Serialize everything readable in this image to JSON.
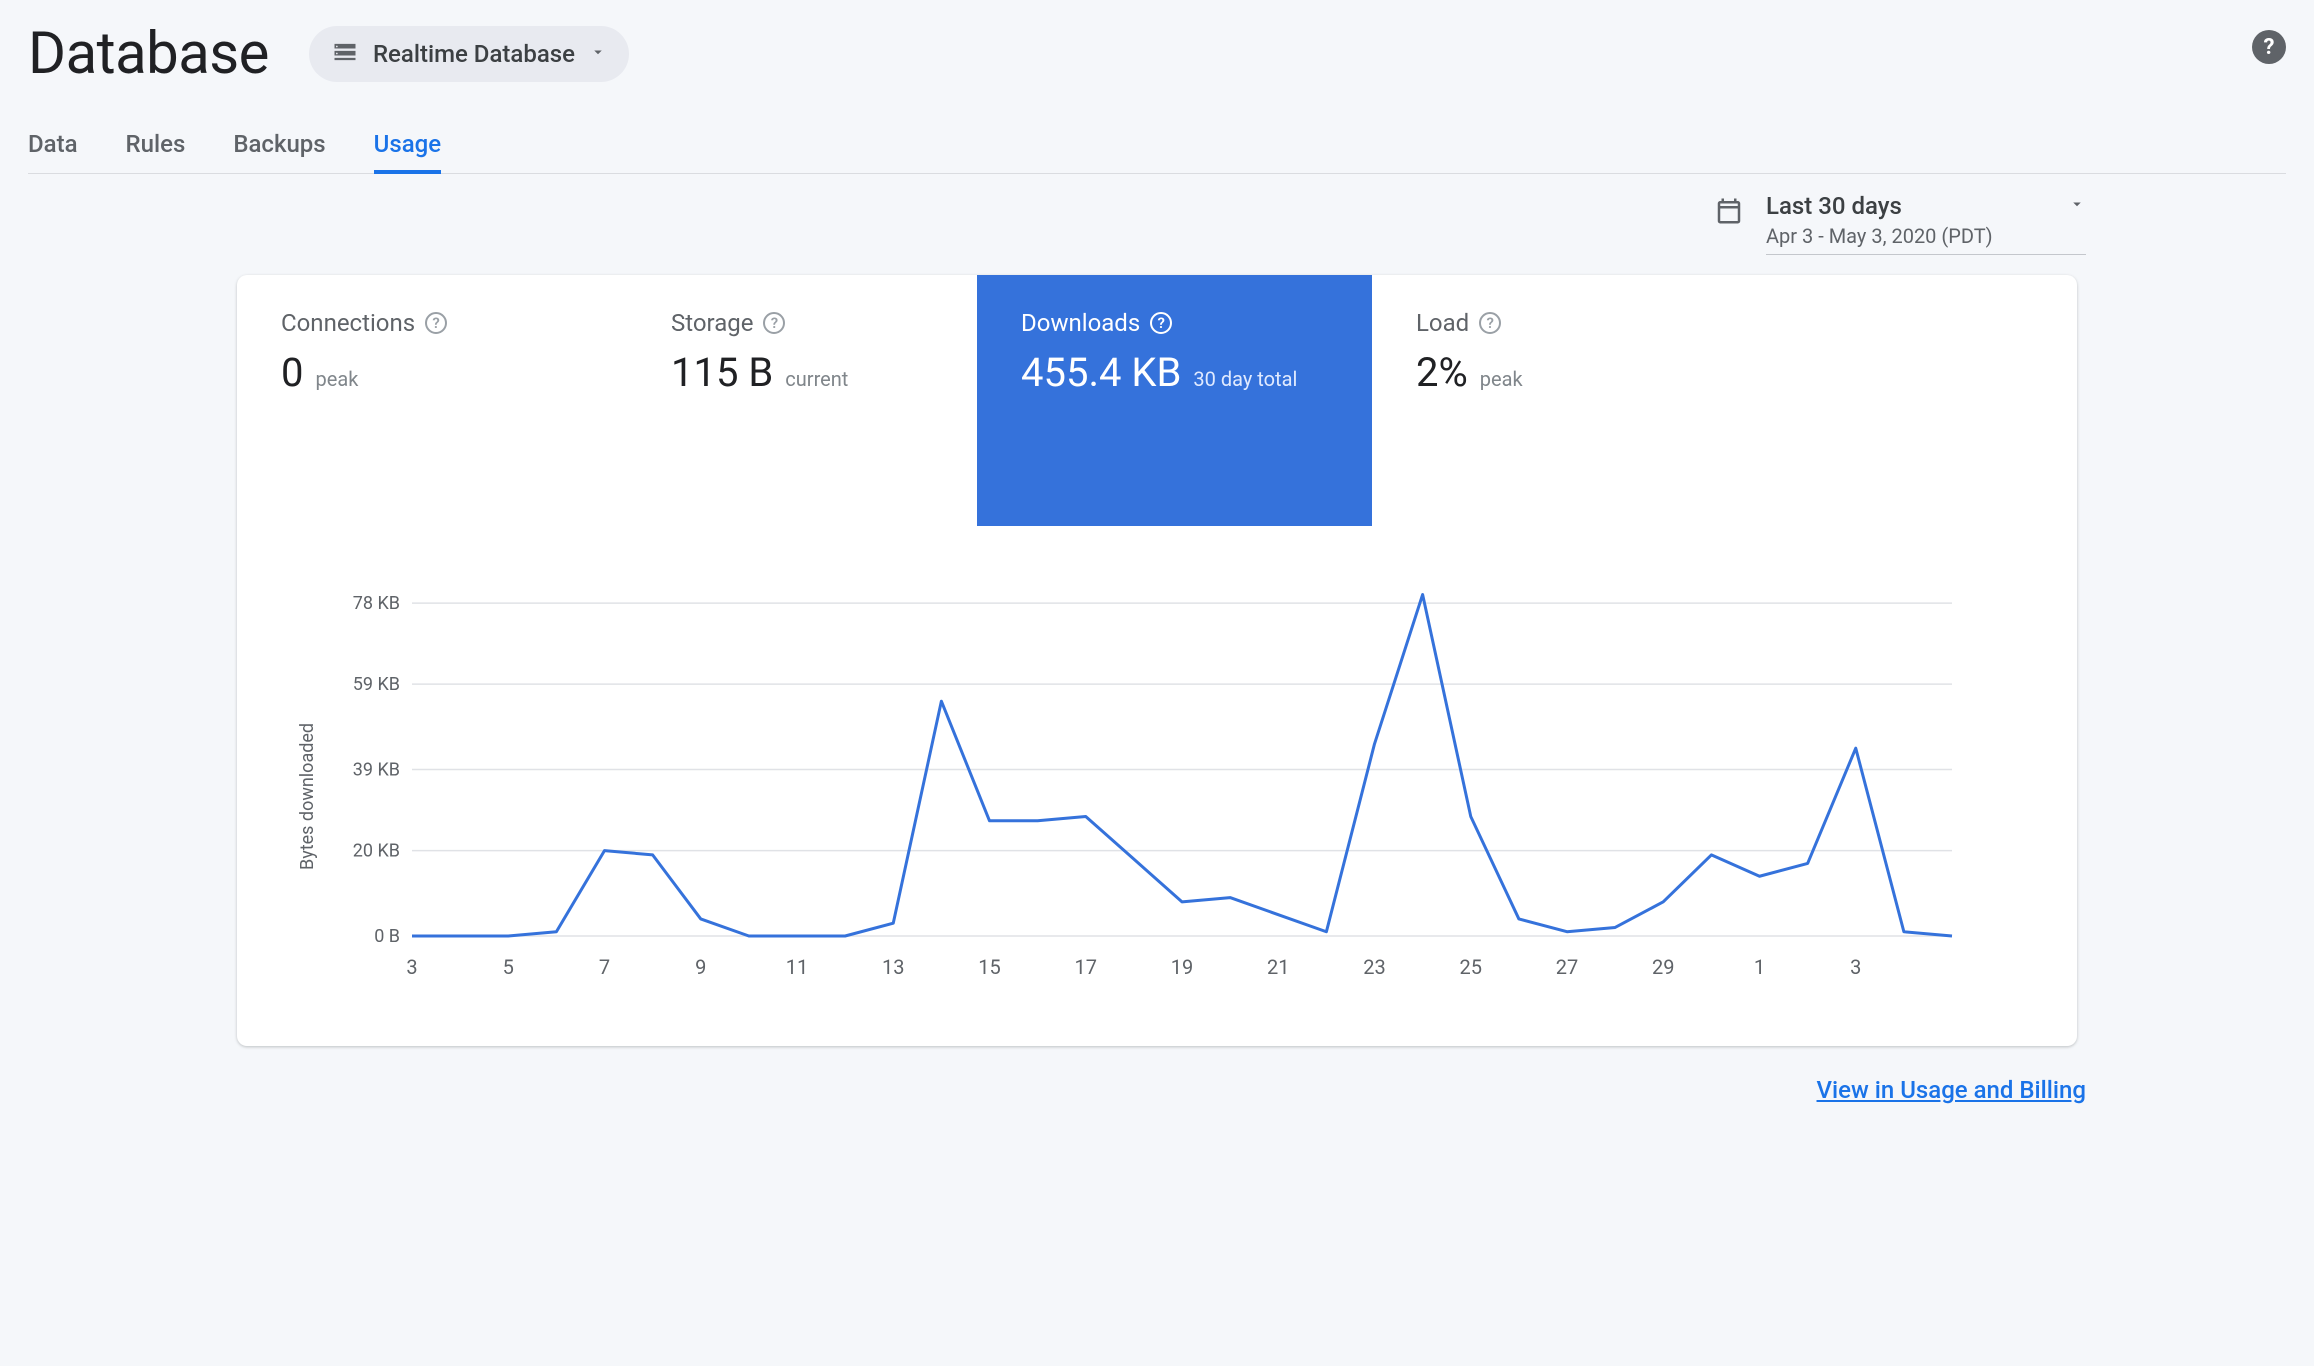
{
  "header": {
    "title": "Database",
    "selector_label": "Realtime Database"
  },
  "tabs": [
    "Data",
    "Rules",
    "Backups",
    "Usage"
  ],
  "active_tab": "Usage",
  "date_picker": {
    "range_label": "Last 30 days",
    "range_sub": "Apr 3 - May 3, 2020 (PDT)"
  },
  "metrics": {
    "connections": {
      "title": "Connections",
      "value": "0",
      "sub": "peak"
    },
    "storage": {
      "title": "Storage",
      "value": "115 B",
      "sub": "current"
    },
    "downloads": {
      "title": "Downloads",
      "value": "455.4 KB",
      "sub": "30 day total"
    },
    "load": {
      "title": "Load",
      "value": "2%",
      "sub": "peak"
    }
  },
  "chart_data": {
    "type": "line",
    "title": "",
    "ylabel": "Bytes downloaded",
    "xlabel": "",
    "ylim": [
      0,
      82
    ],
    "y_ticks": [
      0,
      20,
      39,
      59,
      78
    ],
    "y_tick_labels": [
      "0 B",
      "20 KB",
      "39 KB",
      "59 KB",
      "78 KB"
    ],
    "x_tick_labels": [
      "3",
      "5",
      "7",
      "9",
      "11",
      "13",
      "15",
      "17",
      "19",
      "21",
      "23",
      "25",
      "27",
      "29",
      "1",
      "3"
    ],
    "categories": [
      3,
      4,
      5,
      6,
      7,
      8,
      9,
      10,
      11,
      12,
      13,
      14,
      15,
      16,
      17,
      18,
      19,
      20,
      21,
      22,
      23,
      24,
      25,
      26,
      27,
      28,
      29,
      30,
      1,
      2,
      3
    ],
    "values": [
      0,
      0,
      0,
      1,
      20,
      19,
      4,
      0,
      0,
      0,
      3,
      55,
      27,
      27,
      28,
      18,
      8,
      9,
      5,
      1,
      45,
      80,
      28,
      4,
      1,
      2,
      8,
      19,
      14,
      17,
      44,
      1,
      0
    ]
  },
  "footer_link": "View in Usage and Billing"
}
